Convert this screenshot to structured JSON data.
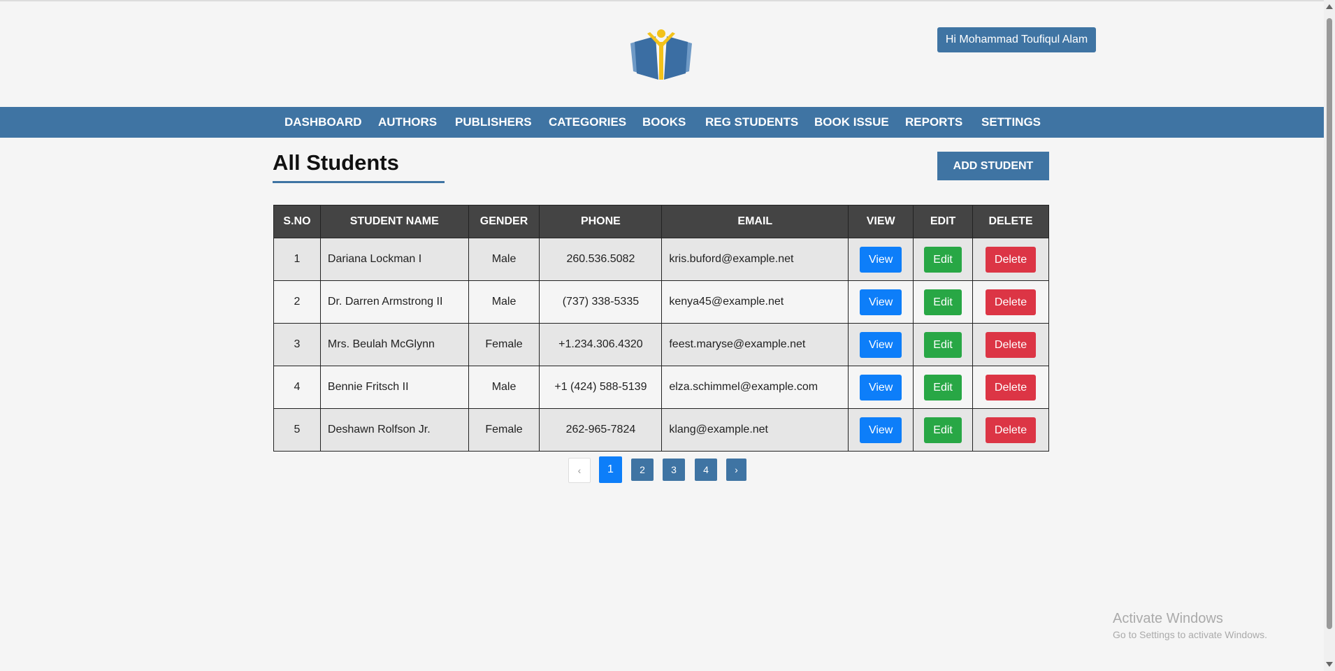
{
  "header": {
    "logo_icon": "open-book-person-icon",
    "user_greeting": "Hi Mohammad Toufiqul Alam"
  },
  "nav": {
    "items": [
      {
        "label": "DASHBOARD"
      },
      {
        "label": "AUTHORS"
      },
      {
        "label": "PUBLISHERS"
      },
      {
        "label": "CATEGORIES"
      },
      {
        "label": "BOOKS"
      },
      {
        "label": "REG STUDENTS"
      },
      {
        "label": "BOOK ISSUE"
      },
      {
        "label": "REPORTS"
      },
      {
        "label": "SETTINGS"
      }
    ]
  },
  "page": {
    "title": "All Students",
    "add_button": "ADD STUDENT"
  },
  "table": {
    "headers": [
      "S.NO",
      "STUDENT NAME",
      "GENDER",
      "PHONE",
      "EMAIL",
      "VIEW",
      "EDIT",
      "DELETE"
    ],
    "rows": [
      {
        "sno": "1",
        "name": "Dariana Lockman I",
        "gender": "Male",
        "phone": "260.536.5082",
        "email": "kris.buford@example.net",
        "view": "View",
        "edit": "Edit",
        "delete": "Delete"
      },
      {
        "sno": "2",
        "name": "Dr. Darren Armstrong II",
        "gender": "Male",
        "phone": "(737) 338-5335",
        "email": "kenya45@example.net",
        "view": "View",
        "edit": "Edit",
        "delete": "Delete"
      },
      {
        "sno": "3",
        "name": "Mrs. Beulah McGlynn",
        "gender": "Female",
        "phone": "+1.234.306.4320",
        "email": "feest.maryse@example.net",
        "view": "View",
        "edit": "Edit",
        "delete": "Delete"
      },
      {
        "sno": "4",
        "name": "Bennie Fritsch II",
        "gender": "Male",
        "phone": "+1 (424) 588-5139",
        "email": "elza.schimmel@example.com",
        "view": "View",
        "edit": "Edit",
        "delete": "Delete"
      },
      {
        "sno": "5",
        "name": "Deshawn Rolfson Jr.",
        "gender": "Female",
        "phone": "262-965-7824",
        "email": "klang@example.net",
        "view": "View",
        "edit": "Edit",
        "delete": "Delete"
      }
    ]
  },
  "pagination": {
    "prev": "‹",
    "pages": [
      "1",
      "2",
      "3",
      "4"
    ],
    "active": "1",
    "next": "›"
  },
  "watermark": {
    "title": "Activate Windows",
    "subtitle": "Go to Settings to activate Windows."
  },
  "colors": {
    "brand": "#3f74a3",
    "view": "#0d7ef9",
    "edit": "#28a745",
    "delete": "#dc3545",
    "table_header": "#444444"
  }
}
